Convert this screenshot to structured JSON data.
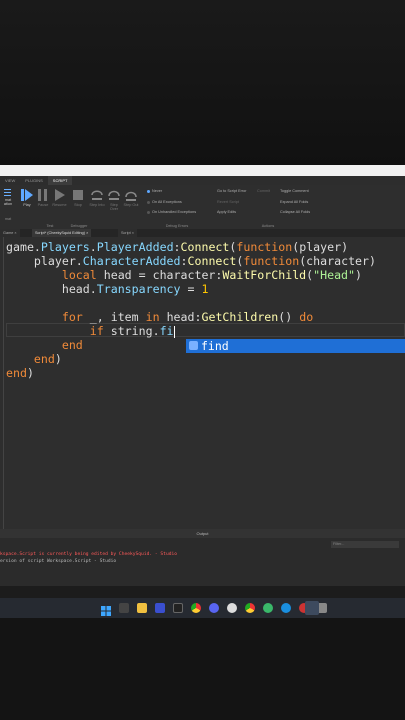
{
  "ribbon": {
    "tabs": [
      "VIEW",
      "PLUGINS",
      "SCRIPT"
    ],
    "debugger": {
      "play": "Play",
      "pause": "Pause",
      "resume": "Resume",
      "stop": "Stop",
      "step_into": "Step Into",
      "step_over": "Step Over",
      "step_out": "Step Out",
      "group_label": "Debugger"
    },
    "debug_errors": {
      "never": "Never",
      "all_exceptions": "On All Exceptions",
      "unhandled": "On Unhandled Exceptions",
      "group_label": "Debug Errors"
    },
    "actions": {
      "goto_script_error": "Go to Script Error",
      "commit": "Commit",
      "revert_script": "Revert Script",
      "apply_edits": "Apply Edits",
      "toggle_comment": "Toggle Comment",
      "expand_all_folds": "Expand All Folds",
      "collapse_all_folds": "Collapse All Folds",
      "group_label": "Actions"
    },
    "left_partial": {
      "format": "mat",
      "format2": "ation",
      "test_label": "Test",
      "left_label": "mat"
    }
  },
  "doc_tabs": [
    {
      "label": "Game"
    },
    {
      "label": "Script* (CheekySquid Editing)"
    },
    {
      "label": "Script"
    }
  ],
  "editor": {
    "lines": [
      "game.Players.PlayerAdded:Connect(function(player)",
      "    player.CharacterAdded:Connect(function(character)",
      "        local head = character:WaitForChild(\"Head\")",
      "        head.Transparency = 1",
      "",
      "        for _, item in head:GetChildren() do",
      "            if string.fi",
      "        end",
      "    end)",
      "end)"
    ],
    "autocomplete": {
      "suggestion": "find",
      "icon": "function-icon"
    }
  },
  "output": {
    "title": "Output",
    "filter_placeholder": "Filter...",
    "line1": "kspace.Script is currently being edited by CheekySquid.  -  Studio",
    "line2": "ersion of script Workspace.Script  -  Studio"
  },
  "taskbar": {
    "icons": [
      "windows-start-icon",
      "task-view-icon",
      "file-explorer-icon",
      "app-icon",
      "terminal-icon",
      "chrome-icon",
      "discord-icon",
      "obs-icon",
      "chrome-alt-icon",
      "app2-icon",
      "edge-icon",
      "app3-icon",
      "app4-icon",
      "roblox-studio-icon"
    ]
  }
}
